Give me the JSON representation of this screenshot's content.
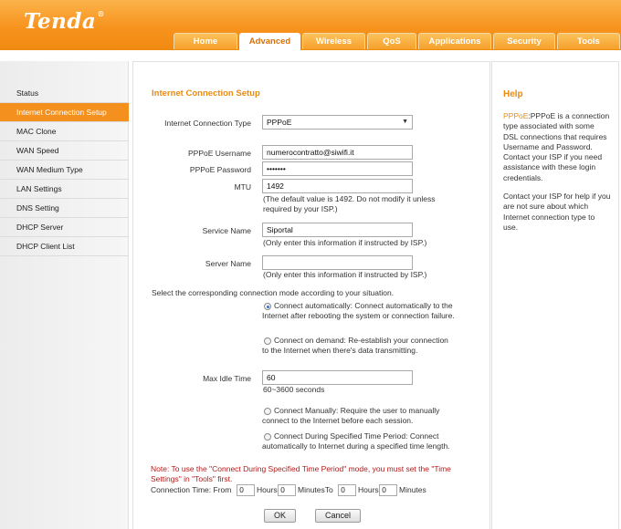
{
  "brand": {
    "name": "Tenda",
    "reg_mark": "®"
  },
  "tabs": [
    {
      "label": "Home"
    },
    {
      "label": "Advanced"
    },
    {
      "label": "Wireless"
    },
    {
      "label": "QoS"
    },
    {
      "label": "Applications"
    },
    {
      "label": "Security"
    },
    {
      "label": "Tools"
    }
  ],
  "active_tab": "Advanced",
  "sidebar": {
    "items": [
      {
        "label": "Status"
      },
      {
        "label": "Internet Connection Setup"
      },
      {
        "label": "MAC Clone"
      },
      {
        "label": "WAN Speed"
      },
      {
        "label": "WAN Medium Type"
      },
      {
        "label": "LAN Settings"
      },
      {
        "label": "DNS Setting"
      },
      {
        "label": "DHCP Server"
      },
      {
        "label": "DHCP Client List"
      }
    ],
    "active": "Internet Connection Setup"
  },
  "form": {
    "title": "Internet Connection Setup",
    "connection_type": {
      "label": "Internet Connection Type",
      "value": "PPPoE"
    },
    "username": {
      "label": "PPPoE Username",
      "value": "numerocontratto@siwifi.it"
    },
    "password": {
      "label": "PPPoE Password",
      "value": "•••••••"
    },
    "mtu": {
      "label": "MTU",
      "value": "1492",
      "hint": "(The default value is 1492. Do not modify it unless required by your ISP.)"
    },
    "service_name": {
      "label": "Service Name",
      "value": "Siportal",
      "hint": "(Only enter this information if instructed by ISP.)"
    },
    "server_name": {
      "label": "Server Name",
      "value": "",
      "hint": "(Only enter this information if instructed by ISP.)"
    },
    "mode_intro": "Select the corresponding connection mode according to your situation.",
    "modes": {
      "auto": "Connect automatically: Connect automatically to the Internet after rebooting the system or connection failure.",
      "on_demand": "Connect on demand: Re-establish your connection to the Internet when there's data transmitting.",
      "manual": "Connect Manually: Require the user to manually connect to the Internet before each session.",
      "period": "Connect During Specified Time Period: Connect automatically to Internet during a specified time length."
    },
    "selected_mode": "auto",
    "max_idle": {
      "label": "Max Idle Time",
      "value": "60",
      "range": "60~3600 seconds"
    },
    "note": "Note: To use the \"Connect During Specified Time Period\" mode, you must set the \"Time Settings\" in \"Tools\" first.",
    "connection_time": {
      "label": "Connection Time: From",
      "from_hours": "0",
      "hours_label": "Hours",
      "from_minutes": "0",
      "minutes_to_label": "MinutesTo",
      "to_hours": "0",
      "hours2_label": "Hours",
      "to_minutes": "0",
      "minutes_label": "Minutes"
    },
    "ok_label": "OK",
    "cancel_label": "Cancel"
  },
  "help": {
    "title": "Help",
    "keyword": "PPPoE",
    "text1": ":PPPoE is a connection type associated with some DSL connections that requires Username and Password. Contact your ISP if you need assistance with these login credentials.",
    "text2": "Contact your ISP for help if you are not sure about which Internet connection type to use."
  },
  "colors": {
    "accent": "#f4911e",
    "title": "#ec8a0e",
    "note": "#b31b1b"
  }
}
